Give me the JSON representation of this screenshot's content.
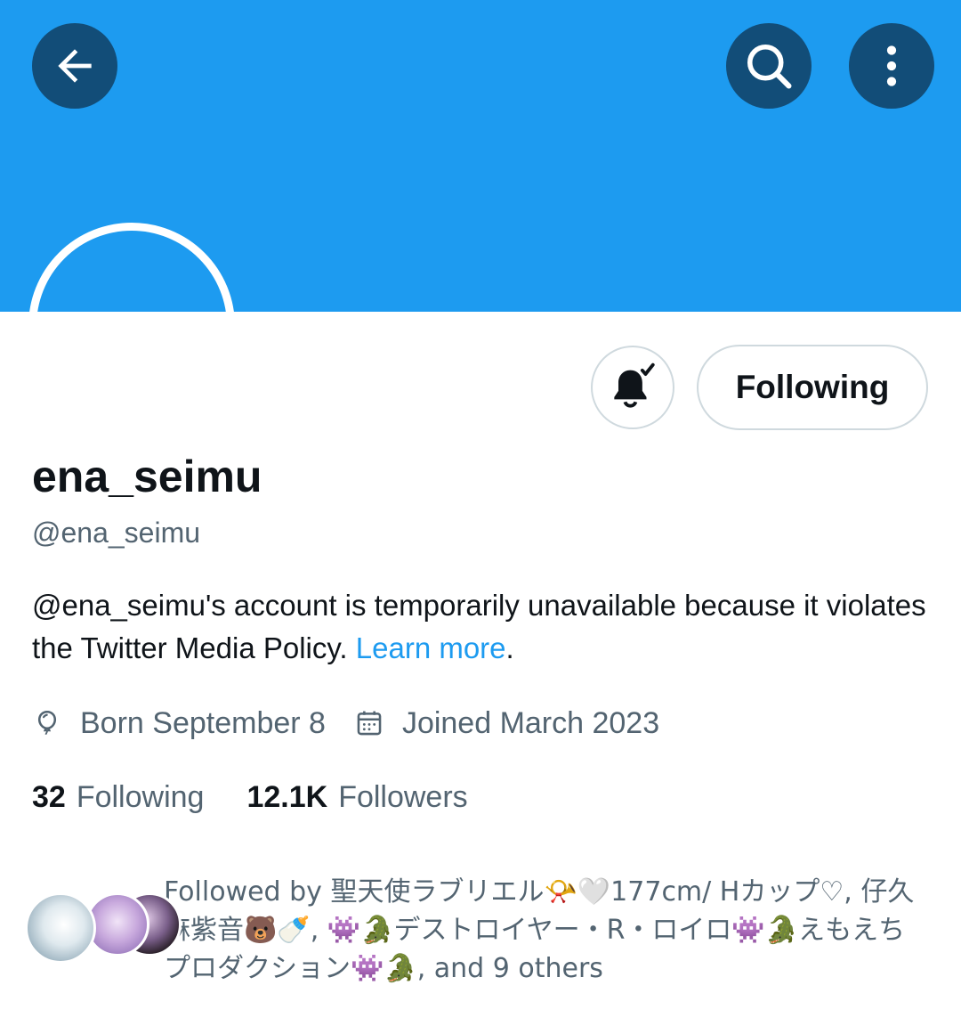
{
  "header": {
    "back_icon": "arrow-left-icon",
    "search_icon": "search-icon",
    "more_icon": "more-vertical-icon",
    "banner_color": "#1d9bf0"
  },
  "actions": {
    "notification_icon": "bell-check-icon",
    "following_label": "Following"
  },
  "profile": {
    "display_name": "ena_seimu",
    "handle": "@ena_seimu",
    "notice_text": "@ena_seimu's account is temporarily unavailable because it violates the Twitter Media Policy. ",
    "notice_link": "Learn more",
    "notice_end": ".",
    "born": "Born September 8",
    "joined": "Joined March 2023"
  },
  "stats": {
    "following_count": "32",
    "following_label": "Following",
    "followers_count": "12.1K",
    "followers_label": "Followers"
  },
  "followed_by": {
    "text": "Followed by 聖天使ラブリエル📯🤍177cm/ Hカップ♡, 仔久麻紫音🐻🍼, 👾🐊デストロイヤー・R・ロイロ👾🐊えもえちプロダクション👾🐊, and 9 others"
  },
  "colors": {
    "accent": "#1d9bf0",
    "secondary_text": "#536471",
    "primary_text": "#0f1419",
    "border": "#cfd9de"
  }
}
